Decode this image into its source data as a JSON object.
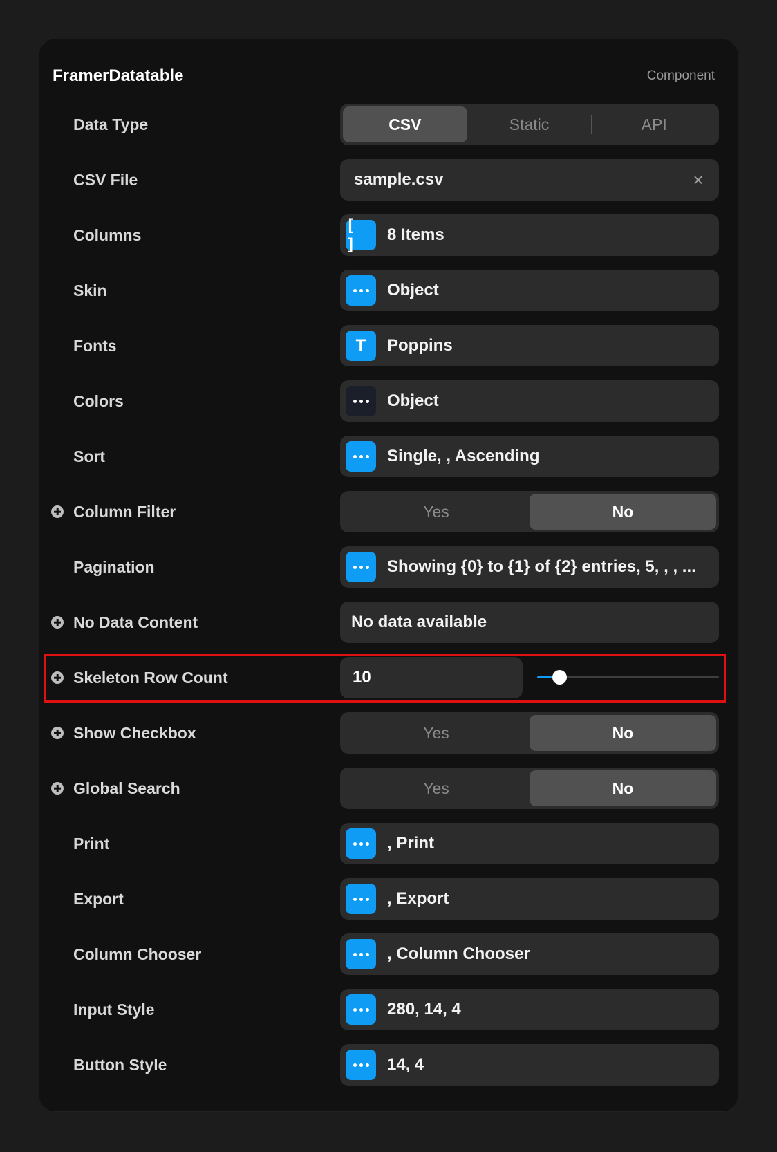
{
  "panel": {
    "title": "FramerDatatable",
    "kind": "Component"
  },
  "data_type": {
    "label": "Data Type",
    "options": [
      "CSV",
      "Static",
      "API"
    ],
    "selected": "CSV"
  },
  "csv_file": {
    "label": "CSV File",
    "value": "sample.csv",
    "clear_icon": "close-icon"
  },
  "columns": {
    "label": "Columns",
    "value": "8 Items",
    "icon": "array-brackets-icon",
    "icon_glyph": "[ ]"
  },
  "skin": {
    "label": "Skin",
    "value": "Object",
    "icon": "ellipsis-icon"
  },
  "fonts": {
    "label": "Fonts",
    "value": "Poppins",
    "icon": "text-t-icon",
    "icon_glyph": "T"
  },
  "colors": {
    "label": "Colors",
    "value": "Object",
    "icon": "ellipsis-icon"
  },
  "sort": {
    "label": "Sort",
    "value": "Single, , Ascending",
    "icon": "ellipsis-icon"
  },
  "column_filter": {
    "label": "Column Filter",
    "yes": "Yes",
    "no": "No",
    "selected": "No"
  },
  "pagination": {
    "label": "Pagination",
    "value": "Showing {0} to {1} of {2} entries, 5, , , ...",
    "icon": "ellipsis-icon"
  },
  "no_data_content": {
    "label": "No Data Content",
    "value": "No data available"
  },
  "skeleton_row_count": {
    "label": "Skeleton Row Count",
    "value": "10",
    "slider_fraction": 0.12
  },
  "show_checkbox": {
    "label": "Show Checkbox",
    "yes": "Yes",
    "no": "No",
    "selected": "No"
  },
  "global_search": {
    "label": "Global Search",
    "yes": "Yes",
    "no": "No",
    "selected": "No"
  },
  "print": {
    "label": "Print",
    "value": ", Print",
    "icon": "ellipsis-icon"
  },
  "export": {
    "label": "Export",
    "value": ", Export",
    "icon": "ellipsis-icon"
  },
  "column_chooser": {
    "label": "Column Chooser",
    "value": ", Column Chooser",
    "icon": "ellipsis-icon"
  },
  "input_style": {
    "label": "Input Style",
    "value": "280, 14, 4",
    "icon": "ellipsis-icon"
  },
  "button_style": {
    "label": "Button Style",
    "value": "14, 4",
    "icon": "ellipsis-icon"
  },
  "colors_map": {
    "accent": "#0e9cf5",
    "highlight": "#e01010",
    "panel_bg": "#111111",
    "field_bg": "#2c2c2c"
  }
}
